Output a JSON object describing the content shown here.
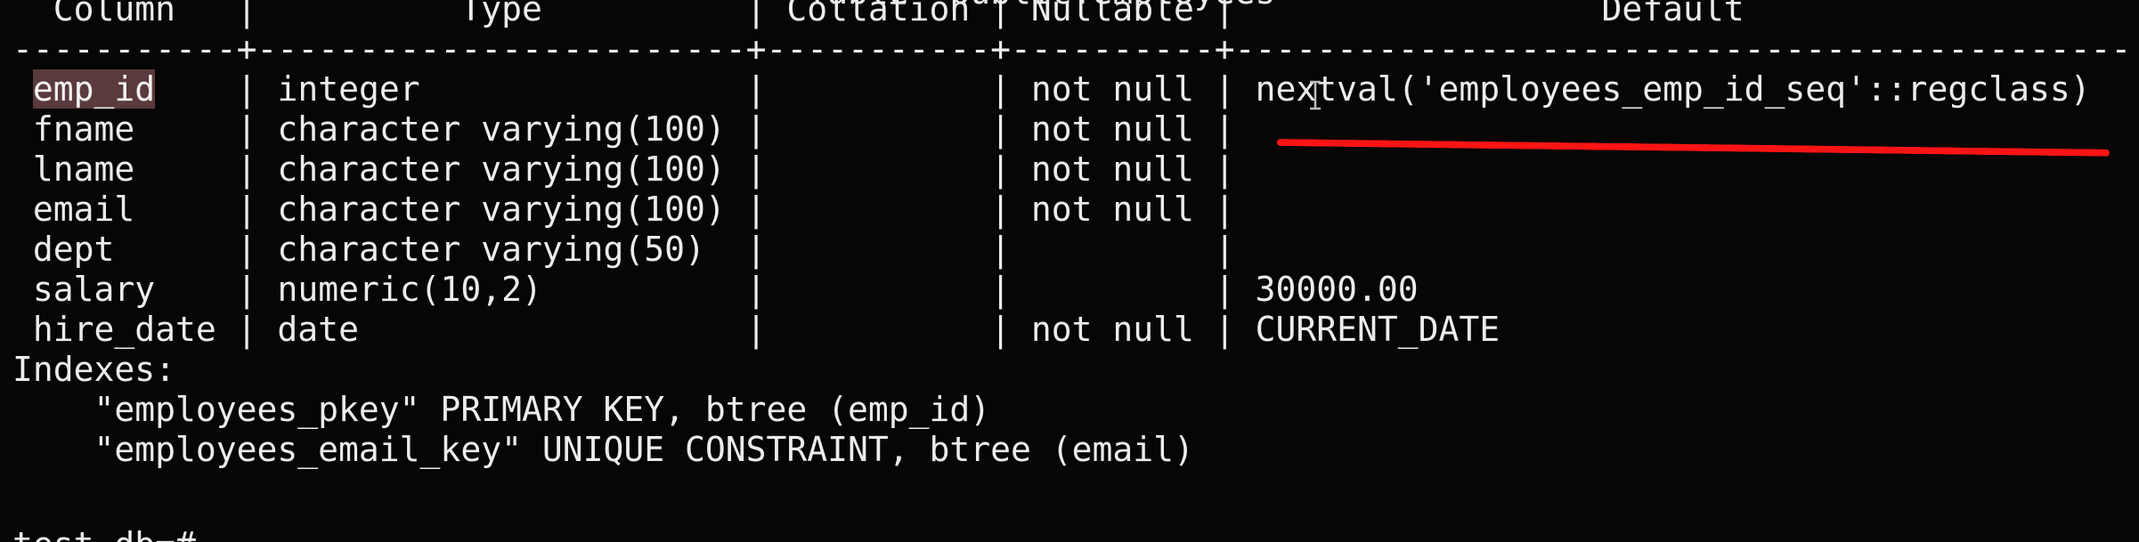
{
  "title_partial": "Table \"public.employees\"",
  "header": {
    "columns": [
      "Column",
      "Type",
      "Collation",
      "Nullable",
      "Default"
    ]
  },
  "separator": "-----------+------------------------+-----------+----------+--------------------------------------------",
  "rows": [
    {
      "column": "emp_id",
      "type": "integer",
      "collation": "",
      "nullable": "not null",
      "default": "nextval('employees_emp_id_seq'::regclass)"
    },
    {
      "column": "fname",
      "type": "character varying(100)",
      "collation": "",
      "nullable": "not null",
      "default": ""
    },
    {
      "column": "lname",
      "type": "character varying(100)",
      "collation": "",
      "nullable": "not null",
      "default": ""
    },
    {
      "column": "email",
      "type": "character varying(100)",
      "collation": "",
      "nullable": "not null",
      "default": ""
    },
    {
      "column": "dept",
      "type": "character varying(50)",
      "collation": "",
      "nullable": "",
      "default": ""
    },
    {
      "column": "salary",
      "type": "numeric(10,2)",
      "collation": "",
      "nullable": "",
      "default": "30000.00"
    },
    {
      "column": "hire_date",
      "type": "date",
      "collation": "",
      "nullable": "not null",
      "default": "CURRENT_DATE"
    }
  ],
  "indexes": {
    "label": "Indexes:",
    "items": [
      "\"employees_pkey\" PRIMARY KEY, btree (emp_id)",
      "\"employees_email_key\" UNIQUE CONSTRAINT, btree (email)"
    ]
  },
  "prompt_partial": "test_db=#",
  "colors": {
    "background": "#060606",
    "text": "#ececec",
    "highlight": "#5a3a3c",
    "annotation_underline": "#ff1414"
  }
}
